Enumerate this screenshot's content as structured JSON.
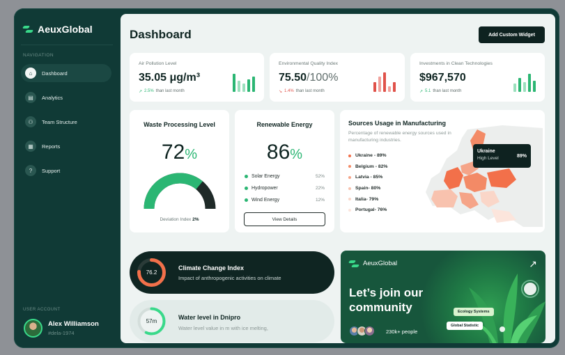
{
  "colors": {
    "accent": "#2bb673",
    "dark": "#0f2522",
    "sidebar": "#103a36",
    "map_high": "#f2704a"
  },
  "sidebar": {
    "brand": "AeuxGlobal",
    "nav_title": "NAVIGATION",
    "items": [
      {
        "label": "Dashboard",
        "icon": "home-icon",
        "active": true
      },
      {
        "label": "Analytics",
        "icon": "analytics-icon"
      },
      {
        "label": "Team Structure",
        "icon": "team-icon"
      },
      {
        "label": "Reports",
        "icon": "reports-icon"
      },
      {
        "label": "Support",
        "icon": "help-icon"
      }
    ],
    "account_title": "USER ACCOUNT",
    "user": {
      "name": "Alex Williamson",
      "handle": "#dela-1974"
    }
  },
  "header": {
    "title": "Dashboard",
    "add_widget": "Add Custom Widget"
  },
  "stats": [
    {
      "label": "Air Pollution Level",
      "value": "35.05 μg/m³",
      "change": "2.5%",
      "change_dir": "up",
      "change_text": "than last month"
    },
    {
      "label": "Environmental Quality Index",
      "value": "75.50",
      "suffix": "/100%",
      "change": "1.4%",
      "change_dir": "down",
      "change_text": "than last month"
    },
    {
      "label": "Investments in Clean Technologies",
      "value": "$967,570",
      "change": "5.1",
      "change_dir": "up",
      "change_text": "than last month"
    }
  ],
  "waste": {
    "title": "Waste Processing Level",
    "value": "72",
    "unit": "%",
    "deviation_label": "Deviation Index",
    "deviation_value": "2%",
    "fill": 0.72
  },
  "renewable": {
    "title": "Renewable Energy",
    "value": "86",
    "unit": "%",
    "items": [
      {
        "label": "Solar Energy",
        "value": "52%"
      },
      {
        "label": "Hydropower",
        "value": "22%"
      },
      {
        "label": "Wind Energy",
        "value": "12%"
      }
    ],
    "button": "View Details"
  },
  "sources": {
    "title": "Sources Usage in Manufacturing",
    "subtitle": "Percentage of renewable energy sources used in manufacturing industries.",
    "items": [
      {
        "label": "Ukraine - 89%",
        "color": "#f2704a"
      },
      {
        "label": "Belgium - 82%",
        "color": "#f38a66"
      },
      {
        "label": "Latvia - 85%",
        "color": "#f5a488"
      },
      {
        "label": "Spain- 80%",
        "color": "#f8c2ae"
      },
      {
        "label": "Italia- 79%",
        "color": "#fad6c8"
      },
      {
        "label": "Portugal- 76%",
        "color": "#fce5dc"
      }
    ],
    "tooltip": {
      "country": "Ukraine",
      "level": "High Level",
      "value": "89%"
    }
  },
  "climate": {
    "value": "76.2",
    "title": "Climate Change Index",
    "subtitle": "Impact of anthropogenic activities on climate",
    "fill": 0.76
  },
  "water": {
    "value": "57m",
    "title": "Water level in Dnipro",
    "subtitle": "Water level value in m with ice melting,",
    "fill": 0.57
  },
  "community": {
    "brand": "AeuxGlobal",
    "title": "Let’s join our community",
    "people": "230k+ people",
    "chip_1": "Ecology Systems",
    "chip_2": "Global Statistic"
  }
}
